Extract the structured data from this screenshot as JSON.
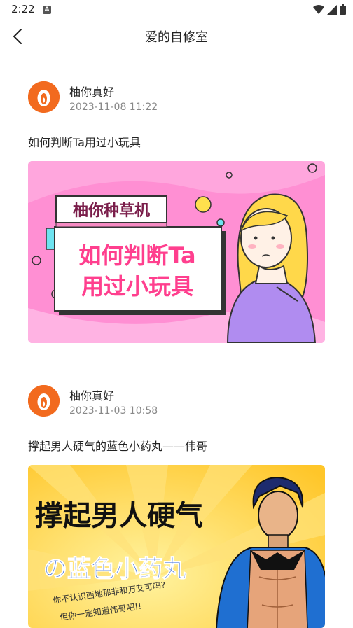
{
  "status": {
    "time": "2:22",
    "badge": "A"
  },
  "nav": {
    "title": "爱的自修室"
  },
  "posts": [
    {
      "author": "柚你真好",
      "time": "2023-11-08 11:22",
      "title": "如何判断Ta用过小玩具",
      "cover": {
        "tag": "柚你种草机",
        "line1": "如何判断Ta",
        "line2": "用过小玩具"
      }
    },
    {
      "author": "柚你真好",
      "time": "2023-11-03 10:58",
      "title": "撑起男人硬气的蓝色小药丸——伟哥",
      "cover": {
        "line1": "撑起男人硬气",
        "line2": "の蓝色小药丸",
        "line3": "你不认识西地那非和万艾可吗?",
        "line4": "但你一定知道伟哥吧!!"
      }
    }
  ],
  "colors": {
    "brand": "#f26a1e",
    "pink_bg": "#ff8fd3",
    "text_pink": "#ff3f8e",
    "yellow_bg": "#ffd24a",
    "blue_text": "#2b63d9"
  }
}
